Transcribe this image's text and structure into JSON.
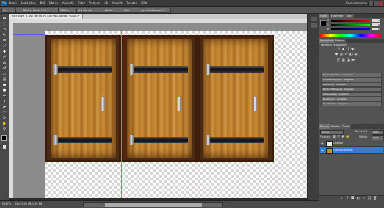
{
  "menubar": {
    "logo": "Ps",
    "items": [
      "Datei",
      "Bearbeiten",
      "Bild",
      "Ebene",
      "Auswahl",
      "Filter",
      "Analyse",
      "3D",
      "Ansicht",
      "Fenster",
      "Hilfe"
    ],
    "workspace": "Grundelemente"
  },
  "options": {
    "tool_preset": "▭",
    "feather": "Weiche Kante: 0 Px",
    "antialias": "Glätten",
    "style": "Art: Normal",
    "width": "Breite:",
    "height": "Höhe:",
    "refine": "Kante verbessern..."
  },
  "document": {
    "tab_title": "holz_türen_3_.psd bei 66,7% (Die Holz-Wände, RGB/8) *"
  },
  "status": {
    "zoom": "66,67%",
    "docsize": "Dok: 3,46 MB/5,38 MB"
  },
  "color_panel": {
    "tabs": [
      "Farbe",
      "Farbfelder",
      "Stile"
    ],
    "r_label": "R",
    "g_label": "G",
    "b_label": "B",
    "r_value": "0",
    "g_value": "0",
    "b_value": "0",
    "fg_color": "#000000",
    "bg_color": "#ffffff"
  },
  "adjust_panel": {
    "tabs": [
      "Korrekturen",
      "Masken"
    ],
    "heading": "Korrektur hinzufügen",
    "presets": [
      "Tonwertkorrektur - Vorgaben",
      "Gradationskurven - Vorgaben",
      "Belichtung - Vorgaben",
      "Farbton/Sättigung - Vorgaben",
      "Schwarzweiß - Vorgaben",
      "Kanalmixer - Vorgaben",
      "Sel. Farbkorr. - Vorgaben"
    ]
  },
  "layers_panel": {
    "tabs": [
      "Ebenen",
      "Kanäle",
      "Pfade"
    ],
    "blend_mode": "Normal",
    "opacity_label": "Deckkraft:",
    "opacity": "100%",
    "lock_label": "Fixieren:",
    "fill_label": "Fläche:",
    "fill": "100%",
    "layers": [
      {
        "name": "Original",
        "selected": false
      },
      {
        "name": "Die Holz-Wände",
        "selected": true
      }
    ]
  }
}
